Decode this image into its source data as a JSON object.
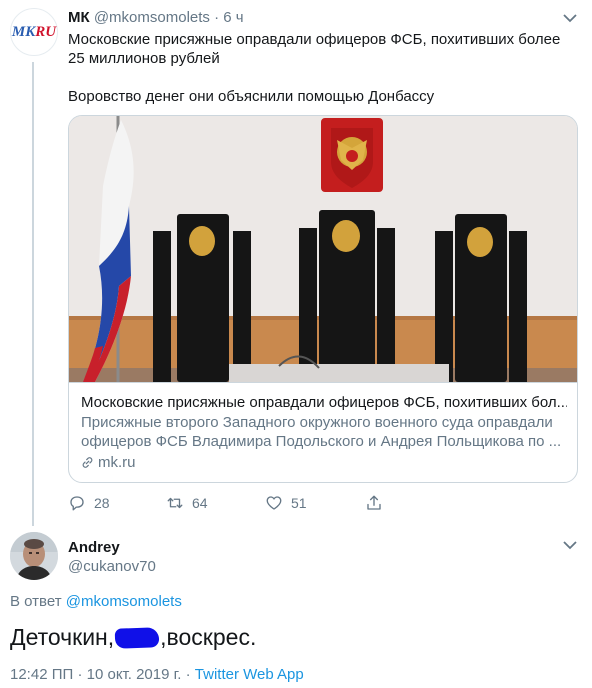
{
  "original_tweet": {
    "avatar_text_mk": "MK",
    "avatar_text_ru": "RU",
    "author_name": "МК",
    "author_handle": "@mkomsomolets",
    "separator": "·",
    "time": "6 ч",
    "text_line1": "Московские присяжные оправдали офицеров ФСБ, похитивших более 25 миллионов рублей",
    "text_line2": "Воровство денег они объяснили помощью Донбассу",
    "card": {
      "title": "Московские присяжные оправдали офицеров ФСБ, похитивших бол...",
      "description": "Присяжные второго Западного окружного военного суда оправдали офицеров ФСБ Владимира Подольского и Андрея Польщикова по ...",
      "domain": "mk.ru",
      "link_icon": "link-icon"
    },
    "actions": {
      "reply_count": "28",
      "retweet_count": "64",
      "like_count": "51",
      "icons": [
        "reply-icon",
        "retweet-icon",
        "like-icon",
        "share-icon"
      ]
    }
  },
  "reply_tweet": {
    "author_name": "Andrey",
    "author_handle": "@cukanov70",
    "reply_prefix": "В ответ",
    "reply_to_handle": "@mkomsomolets",
    "text_before": "Деточкин,",
    "text_after": ",воскрес.",
    "time": "12:42 ПП",
    "separator": "·",
    "date": "10 окт. 2019 г.",
    "app": "Twitter Web App"
  },
  "colors": {
    "accent": "#1b95e0",
    "muted": "#657786",
    "text": "#14171a",
    "redaction": "#1010e8"
  }
}
